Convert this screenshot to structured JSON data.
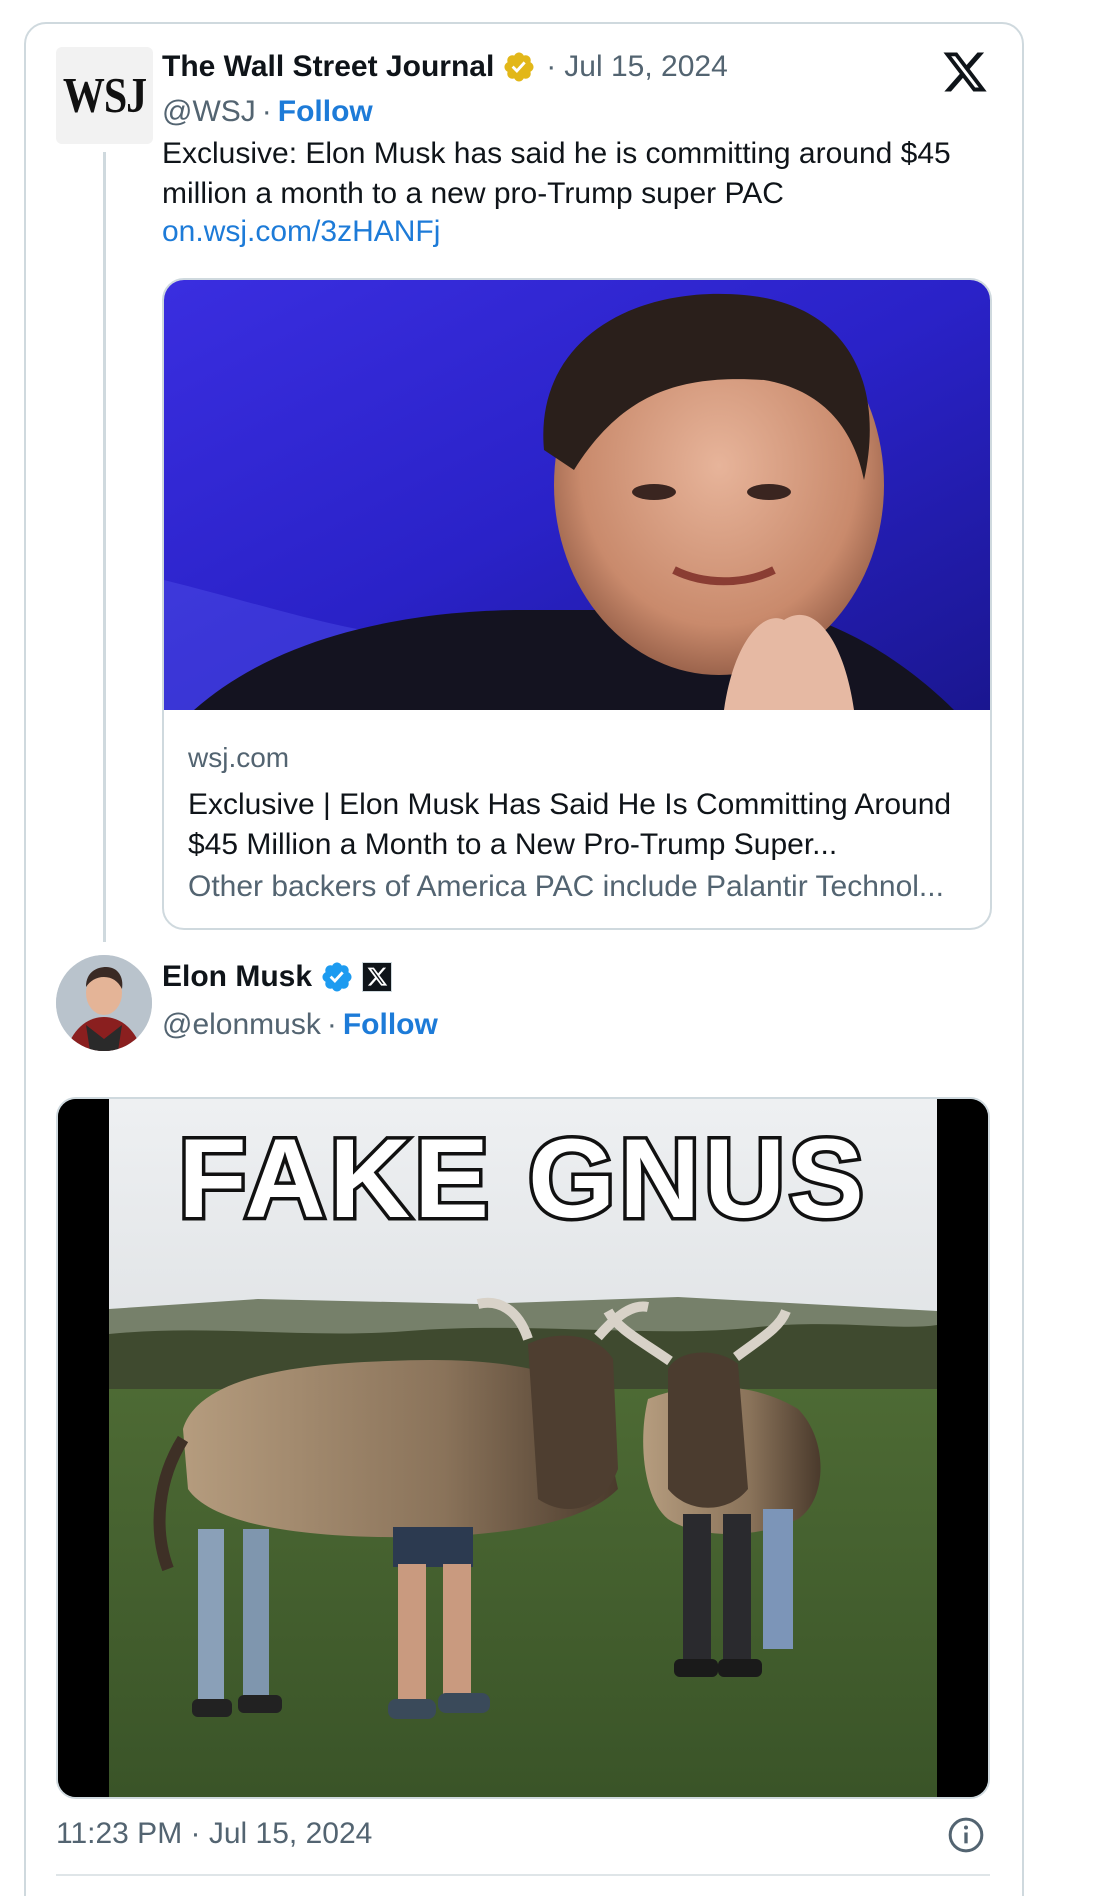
{
  "quoted_tweet": {
    "logo_text": "WSJ",
    "author_name": "The Wall Street Journal",
    "separator_dot": "·",
    "date": "Jul 15, 2024",
    "handle": "@WSJ",
    "follow_label": "Follow",
    "text": "Exclusive: Elon Musk has said he is committing around $45 million a month to a new pro-Trump super PAC",
    "link_text": "on.wsj.com/3zHANFj",
    "link_card": {
      "domain": "wsj.com",
      "title": "Exclusive | Elon Musk Has Said He Is Committing Around $45 Million a Month to a New Pro-Trump Super...",
      "description": "Other backers of America PAC include Palantir Technol..."
    },
    "verified_badge_color": "#e2b719"
  },
  "main_tweet": {
    "author_name": "Elon Musk",
    "handle": "@elonmusk",
    "separator_dot": "·",
    "follow_label": "Follow",
    "verified_badge_color": "#1d9bf0",
    "meme_caption": "FAKE GNUS",
    "time": "11:23 PM",
    "date": "Jul 15, 2024"
  },
  "colors": {
    "link": "#1d7bd8",
    "muted": "#536471",
    "border": "#cfd9de"
  }
}
